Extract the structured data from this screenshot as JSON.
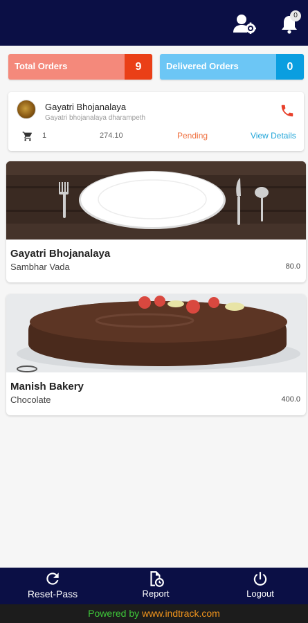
{
  "header": {
    "notification_count": "0",
    "colors": {
      "bar": "#0b0f45"
    }
  },
  "stats": {
    "total_label": "Total Orders",
    "total_value": "9",
    "delivered_label": "Delivered Orders",
    "delivered_value": "0"
  },
  "order": {
    "shop": "Gayatri Bhojanalaya",
    "address": "Gayatri bhojanalaya dharampeth",
    "quantity": "1",
    "amount": "274.10",
    "status": "Pending",
    "view_label": "View Details"
  },
  "products": [
    {
      "shop": "Gayatri Bhojanalaya",
      "item": "Sambhar Vada",
      "price": "80.0"
    },
    {
      "shop": "Manish Bakery",
      "item": "Chocolate",
      "price": "400.0"
    }
  ],
  "bottom_nav": {
    "reset_label": "Reset-Pass",
    "report_label": "Report",
    "logout_label": "Logout"
  },
  "footer": {
    "powered_by": "Powered by",
    "site": "www.indtrack.com"
  },
  "icons": [
    "user-settings-icon",
    "bell-icon",
    "phone-icon",
    "cart-icon",
    "refresh-icon",
    "report-icon",
    "power-icon"
  ]
}
